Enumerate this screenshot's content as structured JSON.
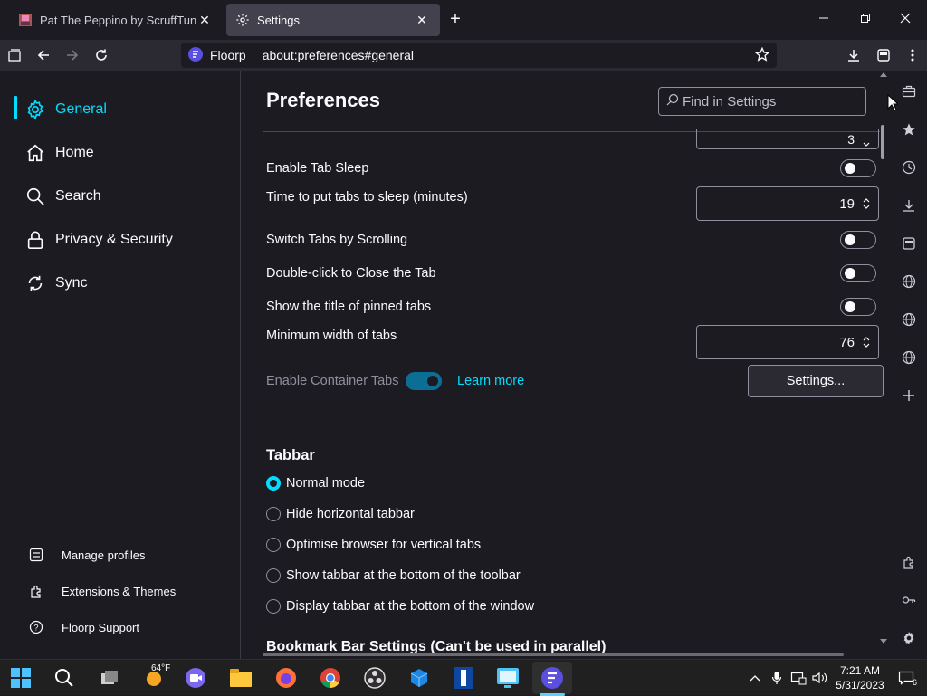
{
  "tabs": [
    {
      "title": "Pat The Peppino by ScruffTuna",
      "icon": "game-favicon"
    },
    {
      "title": "Settings",
      "icon": "gear-icon"
    }
  ],
  "urlbar": {
    "brand": "Floorp",
    "url": "about:preferences#general"
  },
  "categories": [
    {
      "label": "General",
      "icon": "gear-icon",
      "selected": true
    },
    {
      "label": "Home",
      "icon": "home-icon"
    },
    {
      "label": "Search",
      "icon": "search-icon"
    },
    {
      "label": "Privacy & Security",
      "icon": "lock-icon"
    },
    {
      "label": "Sync",
      "icon": "sync-icon"
    }
  ],
  "footer_links": [
    {
      "label": "Manage profiles",
      "icon": "profiles-icon"
    },
    {
      "label": "Extensions & Themes",
      "icon": "puzzle-icon"
    },
    {
      "label": "Floorp Support",
      "icon": "help-icon"
    }
  ],
  "header": {
    "title": "Preferences",
    "search_placeholder": "Find in Settings"
  },
  "settings": {
    "top_partial_value": "3",
    "tab_sleep": {
      "label": "Enable Tab Sleep",
      "checked": false
    },
    "sleep_time": {
      "label": "Time to put tabs to sleep (minutes)",
      "value": "19"
    },
    "switch_scroll": {
      "label": "Switch Tabs by Scrolling",
      "checked": false
    },
    "dblclick_close": {
      "label": "Double-click to Close the Tab",
      "checked": false
    },
    "pinned_title": {
      "label": "Show the title of pinned tabs",
      "checked": false
    },
    "min_width": {
      "label": "Minimum width of tabs",
      "value": "76"
    },
    "container": {
      "label": "Enable Container Tabs",
      "checked": true,
      "learn_more": "Learn more",
      "settings_button": "Settings..."
    }
  },
  "tabbar": {
    "heading": "Tabbar",
    "options": [
      {
        "label": "Normal mode",
        "selected": true
      },
      {
        "label": "Hide horizontal tabbar",
        "selected": false
      },
      {
        "label": "Optimise browser for vertical tabs",
        "selected": false
      },
      {
        "label": "Show tabbar at the bottom of the toolbar",
        "selected": false
      },
      {
        "label": "Display tabbar at the bottom of the window",
        "selected": false
      }
    ]
  },
  "bookmark_heading": "Bookmark Bar Settings (Can't be used in parallel)",
  "taskbar": {
    "weather": "64°F",
    "time": "7:21 AM",
    "date": "5/31/2023",
    "notifications": "6"
  },
  "colors": {
    "accent": "#00ddff",
    "background": "#1c1b22",
    "toolbar": "#2b2a33"
  }
}
